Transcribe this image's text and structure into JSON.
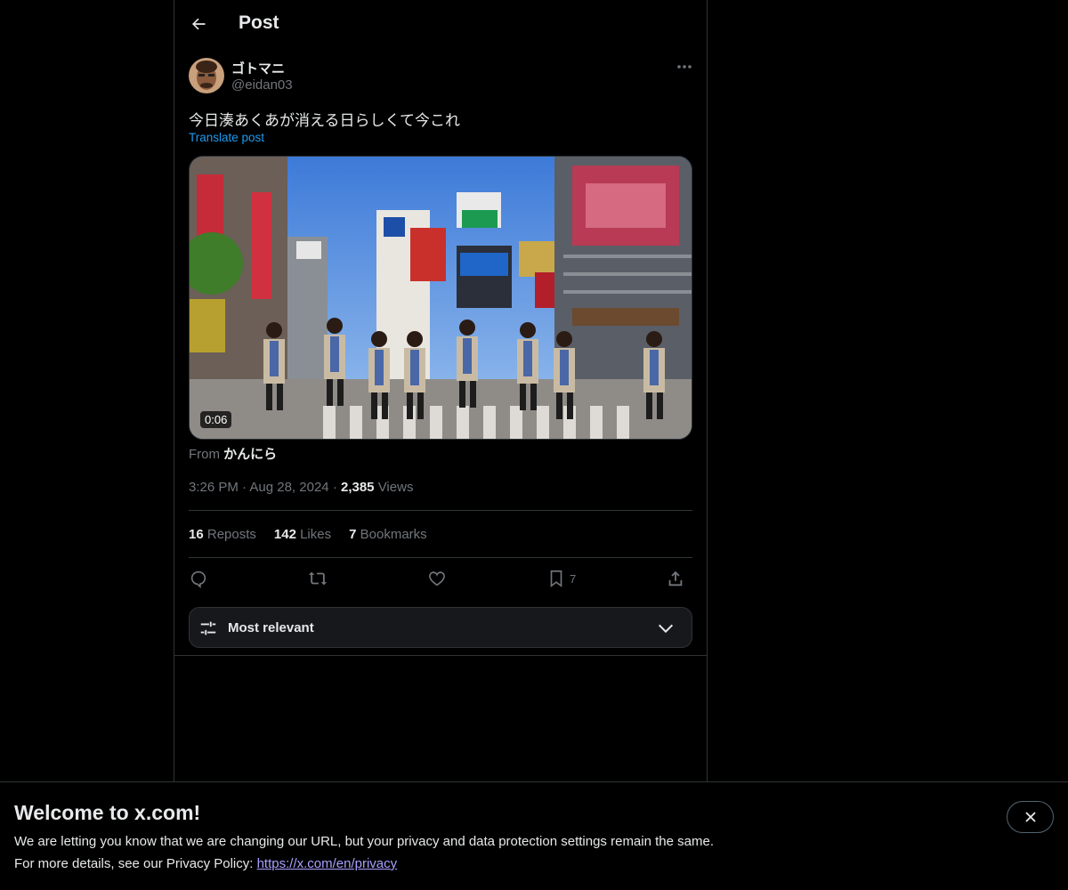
{
  "header": {
    "title": "Post"
  },
  "post": {
    "display_name": "ゴトマニ",
    "handle": "@eidan03",
    "text": "今日湊あくあが消える日らしくて今これ",
    "translate_label": "Translate post",
    "video_duration": "0:06",
    "from_prefix": "From",
    "from_source": "かんにら",
    "time": "3:26 PM",
    "date": "Aug 28, 2024",
    "views_count": "2,385",
    "views_label": "Views"
  },
  "stats": {
    "reposts_count": "16",
    "reposts_label": "Reposts",
    "likes_count": "142",
    "likes_label": "Likes",
    "bookmarks_count": "7",
    "bookmarks_label": "Bookmarks"
  },
  "actions": {
    "bookmark_count": "7"
  },
  "sort": {
    "label": "Most relevant"
  },
  "banner": {
    "title": "Welcome to x.com!",
    "line1": "We are letting you know that we are changing our URL, but your privacy and data protection settings remain the same.",
    "line2_prefix": "For more details, see our Privacy Policy: ",
    "link": "https://x.com/en/privacy"
  },
  "colors": {
    "accent": "#1d9bf0",
    "muted": "#71767b",
    "border": "#2f3336",
    "link": "#a8a0ff"
  }
}
